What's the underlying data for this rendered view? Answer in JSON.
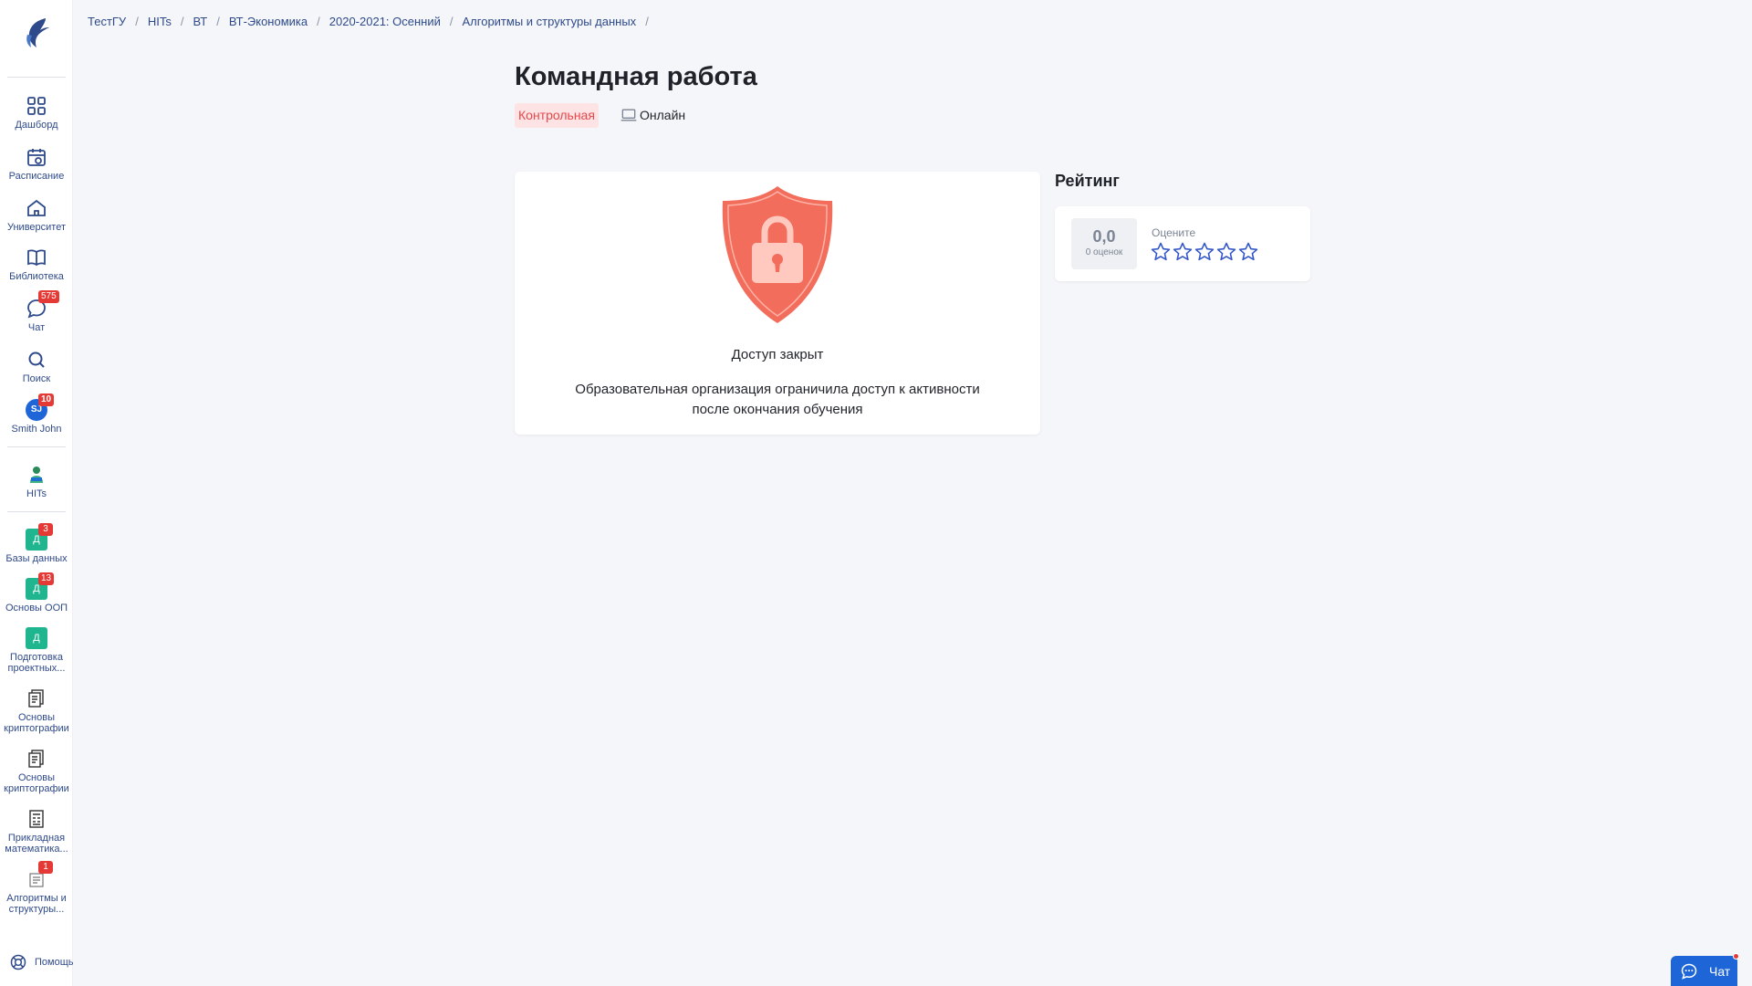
{
  "breadcrumb": [
    {
      "label": "ТестГУ"
    },
    {
      "label": "HITs"
    },
    {
      "label": "ВТ"
    },
    {
      "label": "ВТ-Экономика"
    },
    {
      "label": "2020-2021: Осенний"
    },
    {
      "label": "Алгоритмы и структуры данных"
    }
  ],
  "sidebar": {
    "items": [
      {
        "label": "Дашборд",
        "icon": "grid-icon"
      },
      {
        "label": "Расписание",
        "icon": "calendar-icon"
      },
      {
        "label": "Университет",
        "icon": "home-icon"
      },
      {
        "label": "Библиотека",
        "icon": "book-icon"
      },
      {
        "label": "Чат",
        "icon": "chat-icon",
        "badge": "575"
      },
      {
        "label": "Поиск",
        "icon": "search-icon"
      },
      {
        "label": "Smith John",
        "avatar": "SJ",
        "badge": "10"
      },
      {
        "label": "HITs",
        "icon": "hits-logo-icon"
      },
      {
        "label": "Базы данных",
        "square": "Д",
        "badge": "3"
      },
      {
        "label": "Основы ООП",
        "square": "Д",
        "badge": "13"
      },
      {
        "label": "Подготовка проектных...",
        "square": "Д"
      },
      {
        "label": "Основы криптографии",
        "icon": "course-icon"
      },
      {
        "label": "Основы криптографии",
        "icon": "course-icon"
      },
      {
        "label": "Прикладная математика...",
        "icon": "course-icon"
      },
      {
        "label": "Алгоритмы и структуры...",
        "icon": "course-icon",
        "badge": "1"
      }
    ],
    "help_label": "Помощь"
  },
  "header": {
    "title": "Командная работа",
    "tag_type": "Контрольная",
    "tag_mode": "Онлайн"
  },
  "access": {
    "title": "Доступ закрыт",
    "text": "Образовательная организация ограничила доступ к активности после окончания обучения"
  },
  "rating": {
    "title": "Рейтинг",
    "value": "0,0",
    "count": "0 оценок",
    "prompt": "Оцените",
    "max_stars": 5,
    "current_stars": 0
  },
  "chat_button": {
    "label": "Чат"
  },
  "colors": {
    "accent": "#1e66d8",
    "shield": "#f26d5b",
    "badge": "#e53935",
    "tag_bg": "#fde3e3",
    "tag_text": "#e5484d"
  }
}
